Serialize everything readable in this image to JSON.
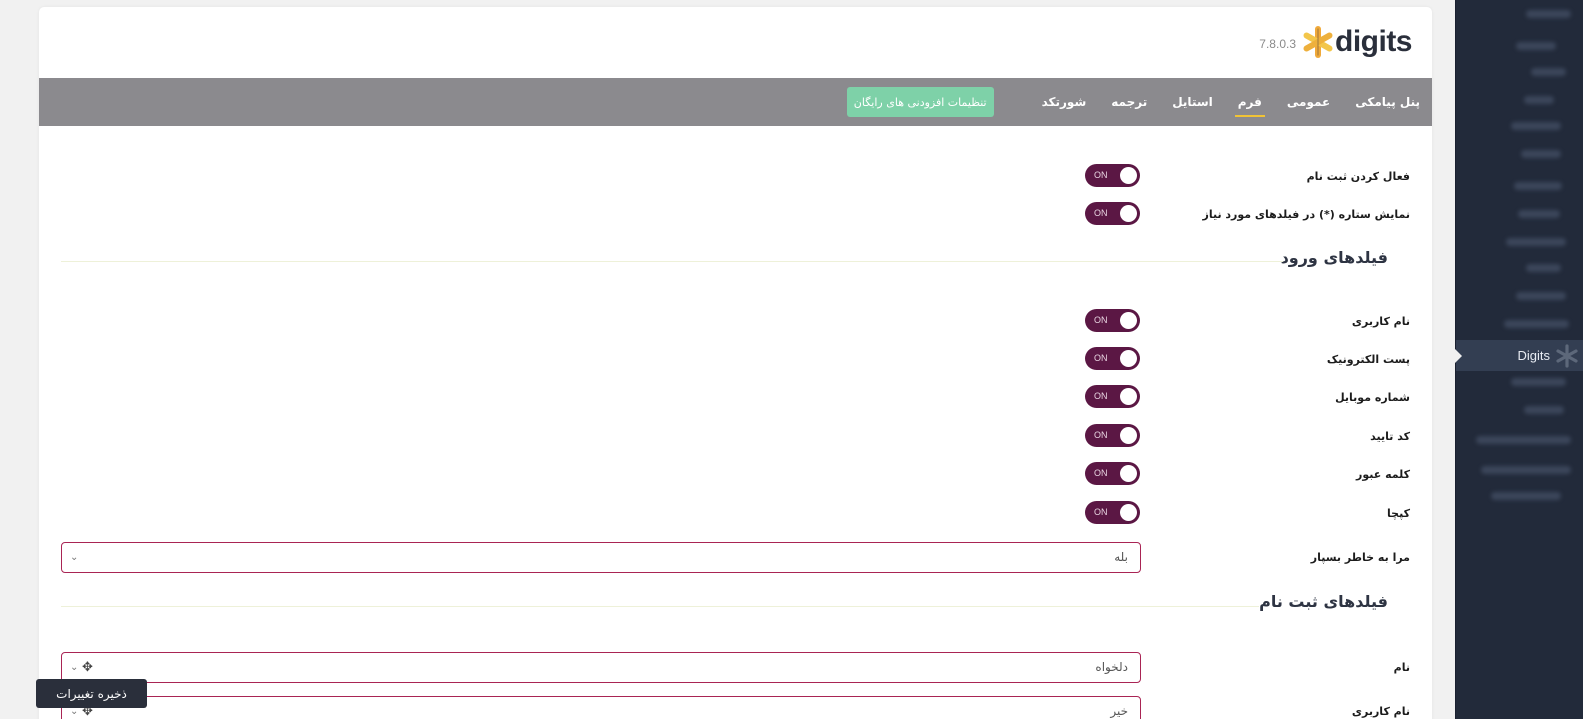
{
  "sidebar": {
    "active_label": "Digits"
  },
  "header": {
    "brand": "digits",
    "version": "7.8.0.3"
  },
  "nav": {
    "tabs": [
      {
        "label": "پنل پیامکی"
      },
      {
        "label": "عمومی"
      },
      {
        "label": "فرم",
        "active": true
      },
      {
        "label": "استایل"
      },
      {
        "label": "ترجمه"
      },
      {
        "label": "شورتکد"
      }
    ],
    "addons_button": "تنظیمات افزودنی های رایگان"
  },
  "toggle_text": "ON",
  "general": {
    "enable_registration": "فعال کردن ثبت نام",
    "show_asterisk": "نمایش ستاره (*) در فیلدهای مورد نیاز"
  },
  "login_fields": {
    "title": "فیلدهای ورود",
    "username": "نام کاربری",
    "email": "پست الکترونیک",
    "mobile": "شماره موبایل",
    "otp": "کد تایید",
    "password": "کلمه عبور",
    "captcha": "کپچا",
    "remember_me": {
      "label": "مرا به خاطر بسپار",
      "value": "بله"
    }
  },
  "register_fields": {
    "title": "فیلدهای ثبت نام",
    "name": {
      "label": "نام",
      "value": "دلخواه"
    },
    "username": {
      "label": "نام کاربری",
      "value": "خیر"
    }
  },
  "save_button": "ذخیره تغییرات",
  "colors": {
    "toggle_on": "#5b1744",
    "nav_bg": "#8b8a8e",
    "active_tab_underline": "#f0c335",
    "addon_button": "#7ed1a8",
    "select_border": "#a92454",
    "sidebar_bg": "#222a3a"
  }
}
